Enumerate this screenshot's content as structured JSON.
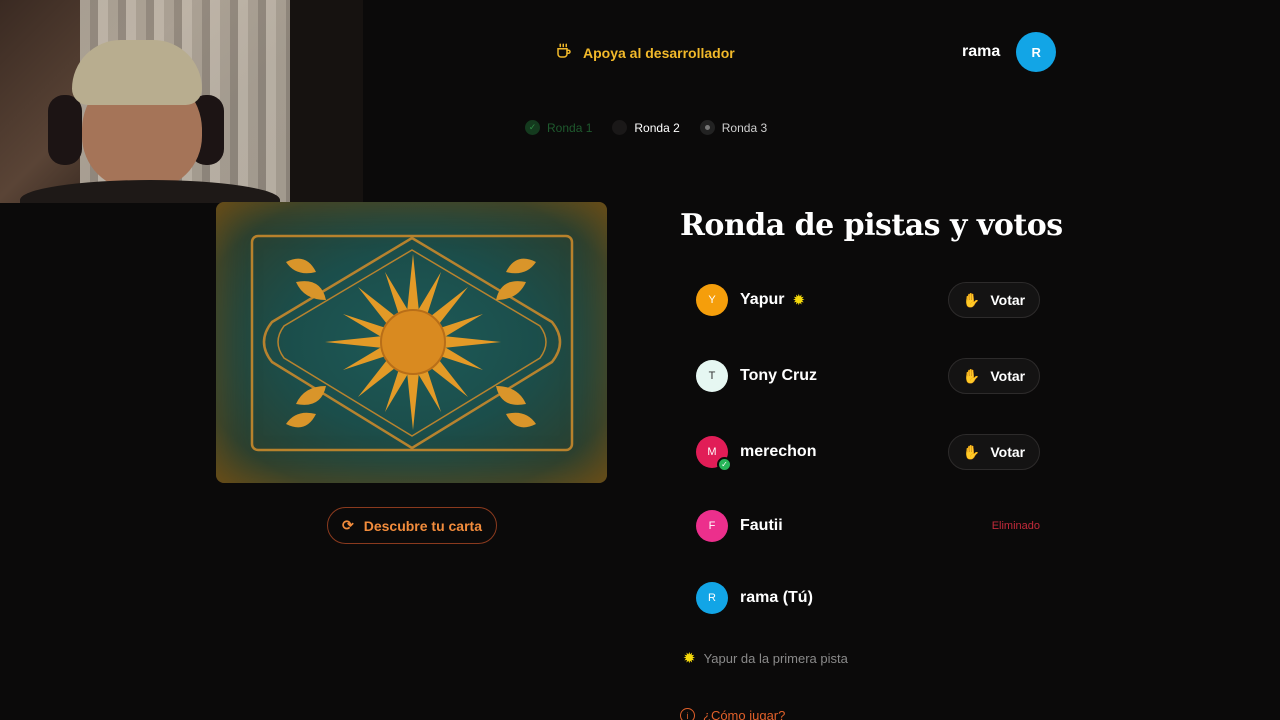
{
  "header": {
    "support_label": "Apoya al desarrollador",
    "user_name": "rama",
    "user_initial": "R"
  },
  "rounds": [
    {
      "label": "Ronda 1",
      "state": "done"
    },
    {
      "label": "Ronda 2",
      "state": "active"
    },
    {
      "label": "Ronda 3",
      "state": "pending"
    }
  ],
  "card": {
    "reveal_label": "Descubre tu carta"
  },
  "main": {
    "title": "Ronda de pistas y votos"
  },
  "players": [
    {
      "initial": "Y",
      "name": "Yapur",
      "color": "#f59e0b",
      "badge": "sun",
      "action": "Votar"
    },
    {
      "initial": "T",
      "name": "Tony Cruz",
      "color": "#e6f7f2",
      "action": "Votar"
    },
    {
      "initial": "M",
      "name": "merechon",
      "color": "#e11d57",
      "voted": true,
      "action": "Votar"
    },
    {
      "initial": "F",
      "name": "Fautii",
      "color": "#ec2f8c",
      "status": "Eliminado"
    },
    {
      "initial": "R",
      "name": "rama (Tú)",
      "color": "#12a5e6"
    }
  ],
  "hint": {
    "text": "Yapur da la primera pista"
  },
  "howto": {
    "label": "¿Cómo jugar?"
  },
  "colors": {
    "accent_gold": "#f2b92a",
    "accent_orange": "#f28c3c",
    "danger": "#c22a3a",
    "background": "#0b0a0a"
  }
}
